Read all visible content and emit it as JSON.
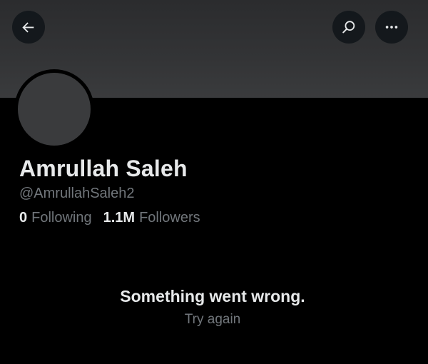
{
  "header": {
    "back_icon": "arrow-left-icon",
    "search_icon": "search-icon",
    "more_icon": "more-horizontal-icon"
  },
  "profile": {
    "display_name": "Amrullah Saleh",
    "handle": "@AmrullahSaleh2",
    "following_count": "0",
    "following_label": "Following",
    "followers_count": "1.1M",
    "followers_label": "Followers"
  },
  "error": {
    "message": "Something went wrong.",
    "retry_label": "Try again"
  },
  "colors": {
    "background": "#000000",
    "banner": "#333436",
    "avatar_placeholder": "#3a3b3d",
    "primary_text": "#e7e9ea",
    "secondary_text": "#71767b"
  }
}
